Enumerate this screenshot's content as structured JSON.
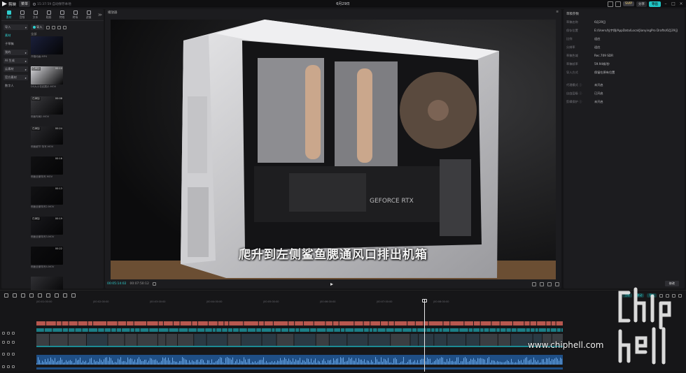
{
  "titlebar": {
    "app_name": "剪映",
    "menu_label": "菜单",
    "autosave": "15:37:59 自动保存本地",
    "doc_title": "6月29日",
    "svip": "SVIP",
    "share_label": "分享",
    "export_label": "导出"
  },
  "left_tabs": [
    {
      "label": "素材",
      "icon": "media-icon",
      "active": true
    },
    {
      "label": "音频",
      "icon": "audio-icon"
    },
    {
      "label": "文本",
      "icon": "text-icon"
    },
    {
      "label": "贴纸",
      "icon": "sticker-icon"
    },
    {
      "label": "特效",
      "icon": "effects-icon"
    },
    {
      "label": "转场",
      "icon": "transition-icon"
    },
    {
      "label": "滤镜",
      "icon": "filter-icon"
    },
    {
      "label": "调节",
      "icon": "adjust-icon"
    },
    {
      "label": "模板",
      "icon": "template-icon"
    },
    {
      "label": "字幕",
      "icon": "caption-icon"
    }
  ],
  "sidenav": [
    {
      "label": "导入",
      "sub": true,
      "arrow": "▾"
    },
    {
      "label": "素材",
      "active": true
    },
    {
      "label": "子草稿"
    },
    {
      "label": "我的",
      "sub": true,
      "arrow": "▸"
    },
    {
      "label": "AI 生成",
      "sub": true,
      "arrow": "▸"
    },
    {
      "label": "云素材",
      "sub": true,
      "arrow": "▸"
    },
    {
      "label": "官方素材",
      "sub": true,
      "arrow": "▸"
    },
    {
      "label": "数字人"
    }
  ],
  "media": {
    "import_label": "导入",
    "all_label": "全部",
    "clips": [
      {
        "name": "开箱动画.MP4",
        "duration": "",
        "tag": "",
        "color": "#1a1f3a"
      },
      {
        "name": "DS大小花纹展示.MOV",
        "duration": "00:10",
        "tag": "已添加",
        "color": "#d8d8dc"
      },
      {
        "name": "侧面布局2.MOV",
        "duration": "00:08",
        "tag": "已添加",
        "color": "#3a3a3e"
      },
      {
        "name": "侧面细节 特写.MOV",
        "duration": "00:24",
        "tag": "已添加",
        "color": "#2a2a2e"
      },
      {
        "name": "侧面全景特写.MOV",
        "duration": "00:16",
        "tag": "",
        "color": "#101012"
      },
      {
        "name": "侧面全景特写2.MOV",
        "duration": "00:13",
        "tag": "",
        "color": "#121214"
      },
      {
        "name": "侧面全景特写3.MOV",
        "duration": "00:19",
        "tag": "已添加",
        "color": "#18181c"
      },
      {
        "name": "侧面全景特写4.MOV",
        "duration": "00:22",
        "tag": "",
        "color": "#0c0c0e"
      },
      {
        "name": "",
        "duration": "",
        "tag": "",
        "color": "#303034"
      }
    ]
  },
  "player": {
    "header": "播放器",
    "subtitle": "爬升到左侧鲨鱼腮通风口排出机箱",
    "current_time": "00:05:14:02",
    "total_time": "00:07:50:12"
  },
  "details": {
    "title": "草稿参数",
    "rows": [
      {
        "k": "草稿名称",
        "v": "6月29日"
      },
      {
        "k": "保存位置",
        "v": "E:/Users/杜宇翔/AppData/Local/JianyingPro Drafts/6月29日"
      },
      {
        "k": "比例",
        "v": "适应"
      },
      {
        "k": "分辨率",
        "v": "适应"
      },
      {
        "k": "草稿色域",
        "v": "Rec.709 SDR"
      },
      {
        "k": "草稿帧率",
        "v": "59.94帧/秒"
      },
      {
        "k": "导入方式",
        "v": "保留在原有位置"
      },
      {
        "k": "",
        "v": "",
        "gap": true
      },
      {
        "k": "代理模式 ⓘ",
        "v": "未开启"
      },
      {
        "k": "自由层级 ⓘ",
        "v": "已开启"
      },
      {
        "k": "剪辑保护 ⓘ",
        "v": "未开启"
      }
    ],
    "modify_label": "修改"
  },
  "timeline": {
    "ruler_ticks": [
      "|00:01:00:00",
      "|00:02:00:00",
      "|00:03:00:00",
      "|00:04:00:00",
      "|00:05:00:00",
      "|00:06:00:00",
      "|00:07:00:00",
      "|00:08:00:00"
    ],
    "pills": [
      "主轨",
      "联动",
      "预览"
    ],
    "audio_label": "音频"
  },
  "watermark": {
    "site": "www.chiphell.com",
    "logo_text": "chip hell"
  }
}
